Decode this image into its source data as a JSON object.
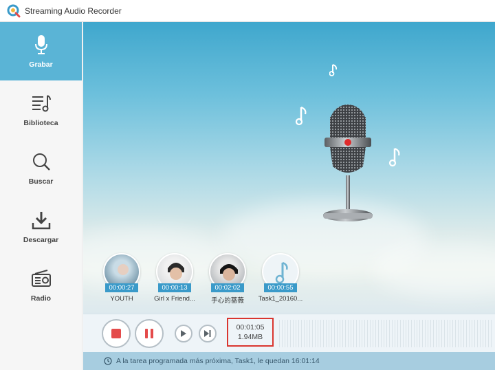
{
  "window": {
    "title": "Streaming Audio Recorder"
  },
  "sidebar": {
    "items": [
      {
        "label": "Grabar",
        "icon": "microphone-icon",
        "active": true
      },
      {
        "label": "Biblioteca",
        "icon": "library-icon",
        "active": false
      },
      {
        "label": "Buscar",
        "icon": "search-icon",
        "active": false
      },
      {
        "label": "Descargar",
        "icon": "download-icon",
        "active": false
      },
      {
        "label": "Radio",
        "icon": "radio-icon",
        "active": false
      }
    ]
  },
  "recent": [
    {
      "duration": "00:00:27",
      "name": "YOUTH"
    },
    {
      "duration": "00:00:13",
      "name": "Girl x Friend..."
    },
    {
      "duration": "00:02:02",
      "name": "手心的蔷薇"
    },
    {
      "duration": "00:00:55",
      "name": "Task1_20160..."
    }
  ],
  "controls": {
    "elapsed": "00:01:05",
    "size": "1.94MB"
  },
  "status": {
    "message": "A la tarea programada más próxima, Task1, le quedan 16:01:14"
  },
  "colors": {
    "accent": "#5ab4d6",
    "record_red": "#e44b4b",
    "badge_blue": "#3a9ac9"
  }
}
